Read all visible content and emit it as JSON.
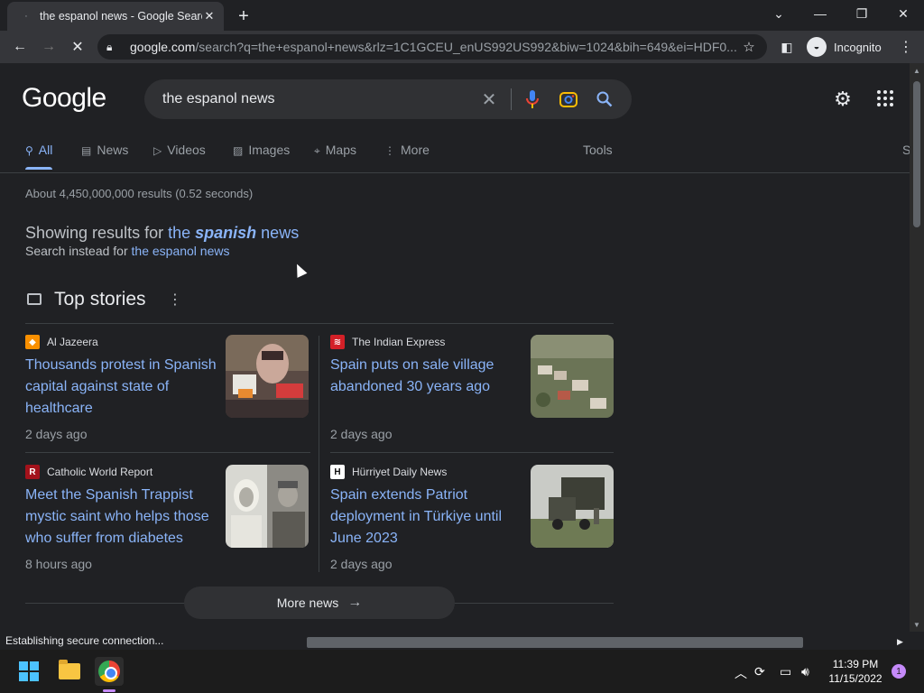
{
  "browser": {
    "tab_title": "the espanol news - Google Search",
    "url_host": "google.com",
    "url_rest": "/search?q=the+espanol+news&rlz=1C1GCEU_enUS992US992&biw=1024&bih=649&ei=HDF0...",
    "incognito_label": "Incognito",
    "status_text": "Establishing secure connection..."
  },
  "google": {
    "logo": "Google",
    "query": "the espanol news",
    "tabs": [
      {
        "label": "All",
        "icon": "search-icon"
      },
      {
        "label": "News",
        "icon": "news-icon"
      },
      {
        "label": "Videos",
        "icon": "video-icon"
      },
      {
        "label": "Images",
        "icon": "image-icon"
      },
      {
        "label": "Maps",
        "icon": "map-pin-icon"
      },
      {
        "label": "More",
        "icon": "more-vert-icon"
      }
    ],
    "tools_label": "Tools",
    "right_cut_label": "S",
    "stats": "About 4,450,000,000 results (0.52 seconds)",
    "showing_prefix": "Showing results for ",
    "showing_the": "the",
    "showing_bold": "spanish",
    "showing_suffix": "news",
    "instead_prefix": "Search instead for ",
    "instead_link": "the espanol news",
    "top_stories_title": "Top stories",
    "more_news": "More news"
  },
  "stories": [
    {
      "source": "Al Jazeera",
      "source_icon_text": "◆",
      "source_color": "#fa9000",
      "headline": "Thousands protest in Spanish capital against state of healthcare",
      "time": "2 days ago"
    },
    {
      "source": "The Indian Express",
      "source_icon_text": "≋",
      "source_color": "#d32027",
      "headline": "Spain puts on sale village abandoned 30 years ago",
      "time": "2 days ago"
    },
    {
      "source": "Catholic World Report",
      "source_icon_text": "R",
      "source_color": "#a3121b",
      "headline": "Meet the Spanish Trappist mystic saint who helps those who suffer from diabetes",
      "time": "8 hours ago"
    },
    {
      "source": "Hürriyet Daily News",
      "source_icon_text": "H",
      "source_color": "#ffffff",
      "headline": "Spain extends Patriot deployment in Türkiye until June 2023",
      "time": "2 days ago"
    }
  ],
  "taskbar": {
    "time": "11:39 PM",
    "date": "11/15/2022",
    "notification_count": "1"
  },
  "colors": {
    "link": "#8ab4f8",
    "background": "#202124",
    "surface": "#303134"
  }
}
